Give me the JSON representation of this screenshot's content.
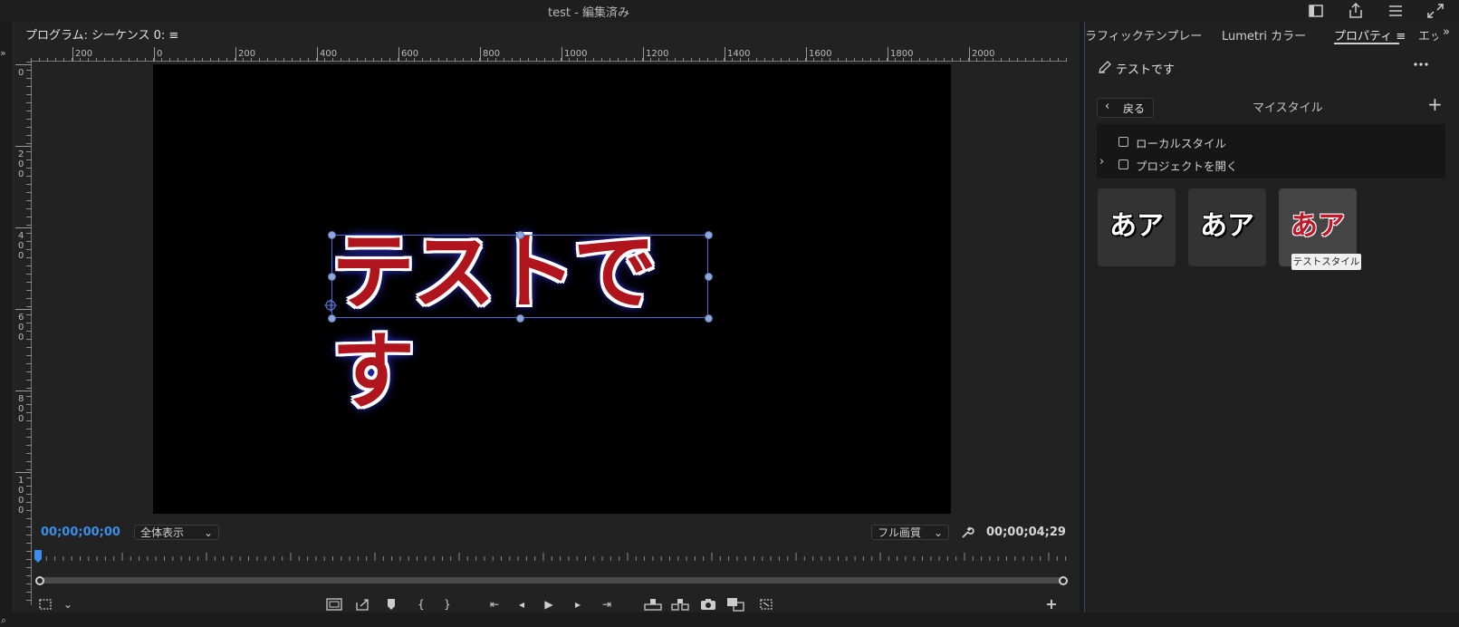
{
  "window": {
    "title": "test - 編集済み"
  },
  "monitor": {
    "title": "プログラム: シーケンス 0: ≡",
    "ruler_h_labels": [
      "200",
      "0",
      "200",
      "400",
      "600",
      "800",
      "1000",
      "1200",
      "1400",
      "1600",
      "1800",
      "2000"
    ],
    "ruler_v_labels": [
      "0",
      "200",
      "400",
      "600",
      "800",
      "1000"
    ],
    "title_text": "テストです",
    "timecode_current": "00;00;00;00",
    "zoom_select": "全体表示",
    "quality_select": "フル画質",
    "timecode_duration": "00;00;04;29"
  },
  "panel": {
    "tabs": [
      "ラフィックテンプレート",
      "Lumetri カラー",
      "プロパティ ≡",
      "エッ"
    ],
    "object_name": "テストです",
    "back_label": "戻る",
    "heading": "マイスタイル",
    "list_items": [
      "ローカルスタイル",
      "プロジェクトを開く"
    ],
    "swatches": [
      {
        "text": "あア",
        "color": "#ffffff"
      },
      {
        "text": "あア",
        "color": "#ffffff"
      },
      {
        "text": "あア",
        "color": "#c0182a"
      }
    ],
    "tooltip": "テストスタイル"
  },
  "colors": {
    "accent": "#3b8eea",
    "title_fill": "#b0151d",
    "selection": "#4b6bd8"
  }
}
